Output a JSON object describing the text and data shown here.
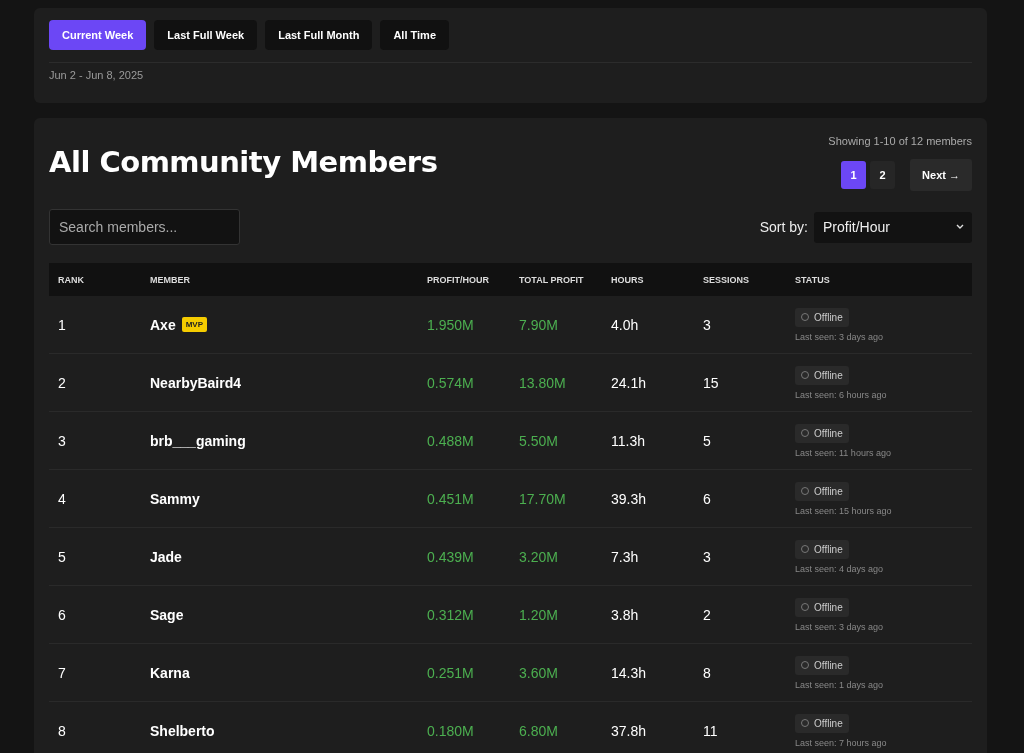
{
  "periods": [
    {
      "label": "Current Week",
      "selected": true
    },
    {
      "label": "Last Full Week",
      "selected": false
    },
    {
      "label": "Last Full Month",
      "selected": false
    },
    {
      "label": "All Time",
      "selected": false
    }
  ],
  "date_range": "Jun 2 - Jun 8, 2025",
  "title": "All Community Members",
  "showing": "Showing 1-10 of 12 members",
  "pages": [
    {
      "label": "1",
      "selected": true
    },
    {
      "label": "2",
      "selected": false
    }
  ],
  "next": "Next →",
  "search": {
    "placeholder": "Search members..."
  },
  "sort": {
    "label": "Sort by:",
    "value": "Profit/Hour"
  },
  "columns": [
    "RANK",
    "MEMBER",
    "PROFIT/HOUR",
    "TOTAL PROFIT",
    "HOURS",
    "SESSIONS",
    "STATUS"
  ],
  "rows": [
    {
      "rank": "1",
      "member": "Axe",
      "badge": "MVP",
      "profit_hour": "1.950M",
      "total_profit": "7.90M",
      "hours": "4.0h",
      "sessions": "3",
      "status": "Offline",
      "online": false,
      "last_seen": "Last seen: 3 days ago"
    },
    {
      "rank": "2",
      "member": "NearbyBaird4",
      "profit_hour": "0.574M",
      "total_profit": "13.80M",
      "hours": "24.1h",
      "sessions": "15",
      "status": "Offline",
      "online": false,
      "last_seen": "Last seen: 6 hours ago"
    },
    {
      "rank": "3",
      "member": "brb___gaming",
      "profit_hour": "0.488M",
      "total_profit": "5.50M",
      "hours": "11.3h",
      "sessions": "5",
      "status": "Offline",
      "online": false,
      "last_seen": "Last seen: 11 hours ago"
    },
    {
      "rank": "4",
      "member": "Sammy",
      "profit_hour": "0.451M",
      "total_profit": "17.70M",
      "hours": "39.3h",
      "sessions": "6",
      "status": "Offline",
      "online": false,
      "last_seen": "Last seen: 15 hours ago"
    },
    {
      "rank": "5",
      "member": "Jade",
      "profit_hour": "0.439M",
      "total_profit": "3.20M",
      "hours": "7.3h",
      "sessions": "3",
      "status": "Offline",
      "online": false,
      "last_seen": "Last seen: 4 days ago"
    },
    {
      "rank": "6",
      "member": "Sage",
      "profit_hour": "0.312M",
      "total_profit": "1.20M",
      "hours": "3.8h",
      "sessions": "2",
      "status": "Offline",
      "online": false,
      "last_seen": "Last seen: 3 days ago"
    },
    {
      "rank": "7",
      "member": "Karna",
      "profit_hour": "0.251M",
      "total_profit": "3.60M",
      "hours": "14.3h",
      "sessions": "8",
      "status": "Offline",
      "online": false,
      "last_seen": "Last seen: 1 days ago"
    },
    {
      "rank": "8",
      "member": "Shelberto",
      "profit_hour": "0.180M",
      "total_profit": "6.80M",
      "hours": "37.8h",
      "sessions": "11",
      "status": "Offline",
      "online": false,
      "last_seen": "Last seen: 7 hours ago"
    }
  ]
}
